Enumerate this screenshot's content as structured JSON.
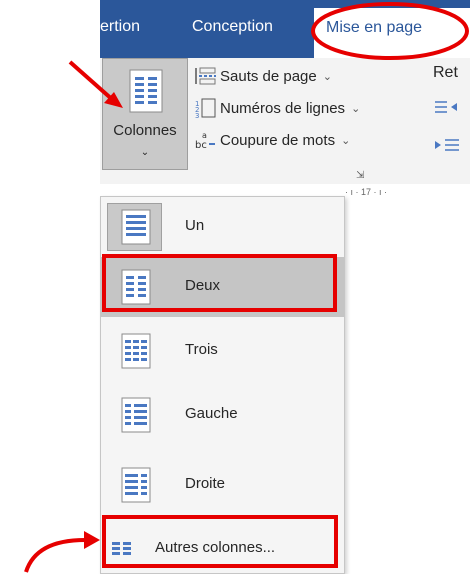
{
  "ribbon": {
    "tabs": [
      {
        "label": "ertion"
      },
      {
        "label": "Conception"
      },
      {
        "label": "Mise en page",
        "active": true
      }
    ],
    "columns_button": {
      "label": "Colonnes",
      "caret": "⌄"
    },
    "commands": [
      {
        "label": "Sauts de page",
        "caret": "⌄",
        "icon": "page-breaks-icon"
      },
      {
        "label": "Numéros de lignes",
        "caret": "⌄",
        "icon": "line-numbers-icon"
      },
      {
        "label": "Coupure de mots",
        "caret": "⌄",
        "icon": "hyphenation-icon"
      }
    ],
    "ret_label": "Ret"
  },
  "ruler_text": "· ı · 17 · ı ·",
  "menu": {
    "items": [
      {
        "label": "Un",
        "icon": "one-column-icon"
      },
      {
        "label": "Deux",
        "icon": "two-columns-icon",
        "selected": true
      },
      {
        "label": "Trois",
        "icon": "three-columns-icon"
      },
      {
        "label": "Gauche",
        "icon": "left-column-icon"
      },
      {
        "label": "Droite",
        "icon": "right-column-icon"
      }
    ],
    "more": {
      "label": "Autres colonnes...",
      "icon": "more-columns-icon"
    }
  },
  "colors": {
    "ribbon_blue": "#2b579a",
    "highlight_red": "#e60000",
    "selection_gray": "#c5c5c5",
    "icon_blue": "#4a78c2"
  }
}
